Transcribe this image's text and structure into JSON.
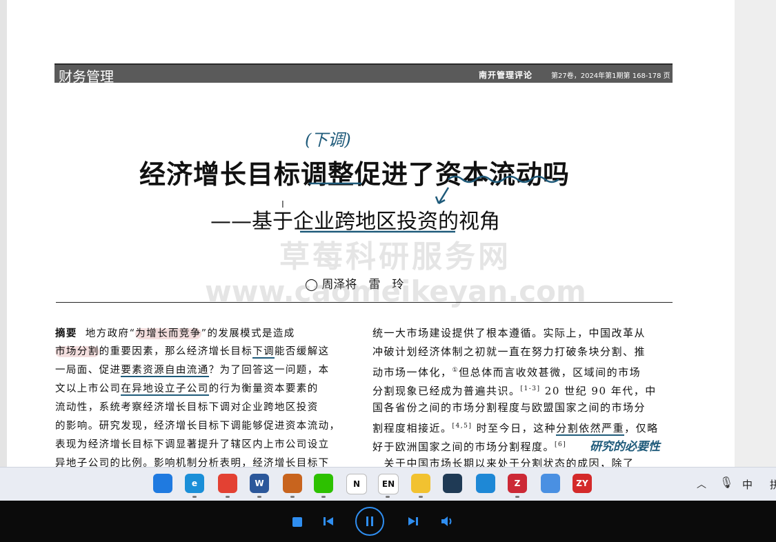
{
  "journal_header": {
    "section": "财务管理",
    "journal_name": "南开管理评论",
    "issue_info": "第27卷，2024年第1期第 168-178 页"
  },
  "annotations": {
    "title_note": "(下调)",
    "body_note": "研究的必要性"
  },
  "paper": {
    "title": "经济增长目标调整促进了资本流动吗",
    "subtitle": "——基于企业跨地区投资的视角",
    "authors": "◯ 周泽将　雷　玲"
  },
  "watermark": {
    "cn": "草莓科研服务网",
    "url": "www.caomeikeyan.com"
  },
  "abstract_lines": [
    [
      "摘要",
      "地方政府“",
      "为增长而竞争",
      "”的发展模式是造成"
    ],
    [
      "市场分割",
      "的重要因素，那么经济增长目标",
      "下调",
      "能否缓解这"
    ],
    [
      "一局面、促进",
      "要素资源自由流通",
      "？为了回答这一问题，本"
    ],
    [
      "文以上市公司",
      "在异地设立子公司",
      "的行为衡量资本要素的"
    ],
    [
      "流动性，系统考察经济增长目标下调对企业跨地区投资"
    ],
    [
      "的影响。研究发现，经济增长目标下调能够促进资本流动，"
    ],
    [
      "表现为经济增长目标下调显著提升了辖区内上市公司设立"
    ],
    [
      "异地子公司的比例。影响机制分析表明，经济增长目标下"
    ]
  ],
  "body_right_lines": [
    [
      "统一大市场建设提供了根本遵循。实际上，中国改革从"
    ],
    [
      "冲破计划经济体制之初就一直在努力打破条块分割、推"
    ],
    [
      "动市场一体化，",
      "①",
      "但总体而言收效甚微，区域间的市场"
    ],
    [
      "分割现象已经成为普遍共识。",
      "[1-3]",
      " 20 世纪 90 年代，中"
    ],
    [
      "国各省份之间的市场分割程度与欧盟国家之间的市场分"
    ],
    [
      "割程度相接近。",
      "[4,5]",
      " 时至今日，这种",
      "分割依然严重",
      "，仅略"
    ],
    [
      "好于欧洲国家之间的市场分割程度。",
      "[6]"
    ],
    [
      "　关于中国市场长期以来处于分割状态的成因，除了"
    ]
  ],
  "taskbar": {
    "apps": [
      {
        "name": "windows-start",
        "label": "",
        "color": "#1f7ae0"
      },
      {
        "name": "edge",
        "label": "e",
        "color": "#1a8fd8"
      },
      {
        "name": "chrome",
        "label": "",
        "color": "#e34133"
      },
      {
        "name": "word",
        "label": "W",
        "color": "#2b579a"
      },
      {
        "name": "search-tool",
        "label": "",
        "color": "#c8641e"
      },
      {
        "name": "wechat",
        "label": "",
        "color": "#2dc100"
      },
      {
        "name": "notion",
        "label": "N",
        "color": "#ffffff"
      },
      {
        "name": "english-dict",
        "label": "EN",
        "color": "#ffffff"
      },
      {
        "name": "file-explorer",
        "label": "",
        "color": "#f2c230"
      },
      {
        "name": "vpn-app",
        "label": "",
        "color": "#1f3a55"
      },
      {
        "name": "blue-app",
        "label": "",
        "color": "#1e88d6"
      },
      {
        "name": "zotero",
        "label": "Z",
        "color": "#cc2936"
      },
      {
        "name": "cloud-drive",
        "label": "",
        "color": "#4a90e2"
      },
      {
        "name": "zy-app",
        "label": "ZY",
        "color": "#d42a2a"
      }
    ],
    "tray": {
      "ime": "中",
      "extra": "拼"
    }
  },
  "player": {
    "state": "playing"
  }
}
